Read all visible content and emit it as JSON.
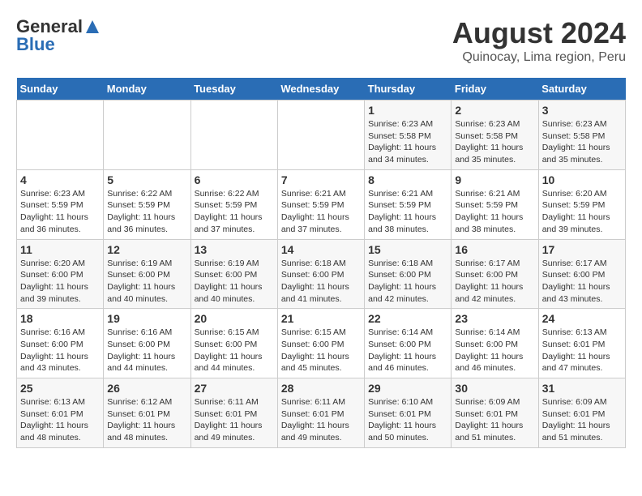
{
  "logo": {
    "general": "General",
    "blue": "Blue"
  },
  "title": "August 2024",
  "subtitle": "Quinocay, Lima region, Peru",
  "days_of_week": [
    "Sunday",
    "Monday",
    "Tuesday",
    "Wednesday",
    "Thursday",
    "Friday",
    "Saturday"
  ],
  "weeks": [
    [
      {
        "day": "",
        "content": ""
      },
      {
        "day": "",
        "content": ""
      },
      {
        "day": "",
        "content": ""
      },
      {
        "day": "",
        "content": ""
      },
      {
        "day": "1",
        "content": "Sunrise: 6:23 AM\nSunset: 5:58 PM\nDaylight: 11 hours and 34 minutes."
      },
      {
        "day": "2",
        "content": "Sunrise: 6:23 AM\nSunset: 5:58 PM\nDaylight: 11 hours and 35 minutes."
      },
      {
        "day": "3",
        "content": "Sunrise: 6:23 AM\nSunset: 5:58 PM\nDaylight: 11 hours and 35 minutes."
      }
    ],
    [
      {
        "day": "4",
        "content": "Sunrise: 6:23 AM\nSunset: 5:59 PM\nDaylight: 11 hours and 36 minutes."
      },
      {
        "day": "5",
        "content": "Sunrise: 6:22 AM\nSunset: 5:59 PM\nDaylight: 11 hours and 36 minutes."
      },
      {
        "day": "6",
        "content": "Sunrise: 6:22 AM\nSunset: 5:59 PM\nDaylight: 11 hours and 37 minutes."
      },
      {
        "day": "7",
        "content": "Sunrise: 6:21 AM\nSunset: 5:59 PM\nDaylight: 11 hours and 37 minutes."
      },
      {
        "day": "8",
        "content": "Sunrise: 6:21 AM\nSunset: 5:59 PM\nDaylight: 11 hours and 38 minutes."
      },
      {
        "day": "9",
        "content": "Sunrise: 6:21 AM\nSunset: 5:59 PM\nDaylight: 11 hours and 38 minutes."
      },
      {
        "day": "10",
        "content": "Sunrise: 6:20 AM\nSunset: 5:59 PM\nDaylight: 11 hours and 39 minutes."
      }
    ],
    [
      {
        "day": "11",
        "content": "Sunrise: 6:20 AM\nSunset: 6:00 PM\nDaylight: 11 hours and 39 minutes."
      },
      {
        "day": "12",
        "content": "Sunrise: 6:19 AM\nSunset: 6:00 PM\nDaylight: 11 hours and 40 minutes."
      },
      {
        "day": "13",
        "content": "Sunrise: 6:19 AM\nSunset: 6:00 PM\nDaylight: 11 hours and 40 minutes."
      },
      {
        "day": "14",
        "content": "Sunrise: 6:18 AM\nSunset: 6:00 PM\nDaylight: 11 hours and 41 minutes."
      },
      {
        "day": "15",
        "content": "Sunrise: 6:18 AM\nSunset: 6:00 PM\nDaylight: 11 hours and 42 minutes."
      },
      {
        "day": "16",
        "content": "Sunrise: 6:17 AM\nSunset: 6:00 PM\nDaylight: 11 hours and 42 minutes."
      },
      {
        "day": "17",
        "content": "Sunrise: 6:17 AM\nSunset: 6:00 PM\nDaylight: 11 hours and 43 minutes."
      }
    ],
    [
      {
        "day": "18",
        "content": "Sunrise: 6:16 AM\nSunset: 6:00 PM\nDaylight: 11 hours and 43 minutes."
      },
      {
        "day": "19",
        "content": "Sunrise: 6:16 AM\nSunset: 6:00 PM\nDaylight: 11 hours and 44 minutes."
      },
      {
        "day": "20",
        "content": "Sunrise: 6:15 AM\nSunset: 6:00 PM\nDaylight: 11 hours and 44 minutes."
      },
      {
        "day": "21",
        "content": "Sunrise: 6:15 AM\nSunset: 6:00 PM\nDaylight: 11 hours and 45 minutes."
      },
      {
        "day": "22",
        "content": "Sunrise: 6:14 AM\nSunset: 6:00 PM\nDaylight: 11 hours and 46 minutes."
      },
      {
        "day": "23",
        "content": "Sunrise: 6:14 AM\nSunset: 6:00 PM\nDaylight: 11 hours and 46 minutes."
      },
      {
        "day": "24",
        "content": "Sunrise: 6:13 AM\nSunset: 6:01 PM\nDaylight: 11 hours and 47 minutes."
      }
    ],
    [
      {
        "day": "25",
        "content": "Sunrise: 6:13 AM\nSunset: 6:01 PM\nDaylight: 11 hours and 48 minutes."
      },
      {
        "day": "26",
        "content": "Sunrise: 6:12 AM\nSunset: 6:01 PM\nDaylight: 11 hours and 48 minutes."
      },
      {
        "day": "27",
        "content": "Sunrise: 6:11 AM\nSunset: 6:01 PM\nDaylight: 11 hours and 49 minutes."
      },
      {
        "day": "28",
        "content": "Sunrise: 6:11 AM\nSunset: 6:01 PM\nDaylight: 11 hours and 49 minutes."
      },
      {
        "day": "29",
        "content": "Sunrise: 6:10 AM\nSunset: 6:01 PM\nDaylight: 11 hours and 50 minutes."
      },
      {
        "day": "30",
        "content": "Sunrise: 6:09 AM\nSunset: 6:01 PM\nDaylight: 11 hours and 51 minutes."
      },
      {
        "day": "31",
        "content": "Sunrise: 6:09 AM\nSunset: 6:01 PM\nDaylight: 11 hours and 51 minutes."
      }
    ]
  ]
}
